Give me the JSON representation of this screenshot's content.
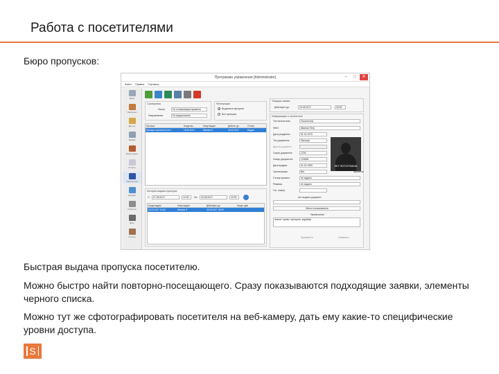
{
  "slide": {
    "title": "Работа с посетителями",
    "subtitle": "Бюро пропусков:",
    "paragraphs": [
      "Быстрая выдача пропуска посетителю.",
      "Можно быстро найти повторно-посещающего. Сразу показываются подходящие заявки, элементы черного списка.",
      "Можно тут же сфотографировать посетителя на веб-камеру, дать ему какие-то специфические уровни доступа."
    ],
    "logo_letter": "S",
    "accent_color": "#e8783c"
  },
  "app": {
    "window_title": "Программа управления [Administrator]",
    "window_controls": [
      "–",
      "□",
      "✕"
    ],
    "menu": [
      "Файл",
      "Правка",
      "Справка"
    ],
    "left_panel": [
      {
        "label": "Бюро",
        "icon": "clipboard-icon"
      },
      {
        "label": "Персонал",
        "icon": "people-icon"
      },
      {
        "label": "Доступ",
        "icon": "shield-icon"
      },
      {
        "label": "Заявки",
        "icon": "form-icon"
      },
      {
        "label": "Мониторинг",
        "icon": "monitor-icon"
      },
      {
        "label": "Отчёты",
        "icon": "report-icon"
      },
      {
        "label": "Посетители",
        "icon": "visitor-icon"
      },
      {
        "label": "Журнал",
        "icon": "log-icon"
      },
      {
        "label": "События",
        "icon": "event-icon"
      },
      {
        "label": "Фото",
        "icon": "photo-icon"
      },
      {
        "label": "Отчеты",
        "icon": "document-icon"
      }
    ],
    "toolbar": [
      {
        "name": "add-visitor-icon",
        "color": "#4f9d3a"
      },
      {
        "name": "edit-visitor-icon",
        "color": "#3b86c8"
      },
      {
        "name": "issue-pass-icon",
        "color": "#2e8a57"
      },
      {
        "name": "refresh-icon",
        "color": "#5a7fa8"
      },
      {
        "name": "print-icon",
        "color": "#7a7a7a"
      },
      {
        "name": "delete-icon",
        "color": "#d23a2a"
      }
    ],
    "sorting": {
      "caption": "Сортировка",
      "key_label": "Поиск:",
      "key_value": "По оставшемуся времени",
      "direction_label": "Направление:",
      "direction_value": "По возрастанию"
    },
    "filtering": {
      "caption": "Фильтрация",
      "option_issued": "Выданные пропуска",
      "option_all": "Все пропуска"
    },
    "passes_grid": {
      "headers": [
        "Пропуск",
        "Когда вы...",
        "Кому выдан",
        "Действ. до",
        "Статус"
      ],
      "rows": [
        [
          "Пропуск посетителя № 1",
          "15.05.2017",
          "Иванов П.",
          "20.05.2017",
          "Выдан"
        ]
      ]
    },
    "history": {
      "caption": "История выдачи пропуска",
      "from_label": "С:",
      "from_date": "07.05.2017",
      "from_time": "12:00",
      "to_label": "По:",
      "to_date": "15.05.2017",
      "to_time": "13:00",
      "headers": [
        "Когда выдан",
        "Кому выдан",
        "Действует до",
        "Когда сдан"
      ],
      "rows": [
        [
          "15.05.2017 10:20",
          "Иванов П.",
          "20.05.2017 09:00",
          ""
        ]
      ]
    },
    "current_pass": {
      "caption": "Текущая заявка",
      "valid_label": "Действует до:",
      "valid_date": "15.05.2017",
      "valid_time": "00:00"
    },
    "visitor_info": {
      "caption": "Информация о посетителе",
      "fields": [
        {
          "label": "Тип посетителя:",
          "value": "Посетитель"
        },
        {
          "label": "ФИО:",
          "value": "Иванов Петр"
        },
        {
          "label": "Дата рождения:",
          "value": "01.01.1970"
        },
        {
          "label": "Тип документа:",
          "value": "Паспорт"
        },
        {
          "label": "Другой документ:",
          "value": ""
        },
        {
          "label": "Серия документа:",
          "value": "1234"
        },
        {
          "label": "Номер документа:",
          "value": "123456"
        },
        {
          "label": "Дата выдачи:",
          "value": "01.01.1990"
        },
        {
          "label": "Организация:",
          "value": "Вег"
        },
        {
          "label": "К кому пришел:",
          "value": "не задано"
        },
        {
          "label": "Режимы:",
          "value": "не задано"
        },
        {
          "label": "Гос. номер:",
          "value": ""
        }
      ],
      "photo_label": "НЕТ ФОТОГРАФИИ",
      "photo_side_label": "архивное",
      "attached_doc_label": "Акт выдачи документ:",
      "user_place_label": "Место пользователя",
      "note_label": "Примечание:",
      "note_value": "значит: право. пропуска. ккуубуки",
      "apply_label": "Применить",
      "cancel_label": "Отменить"
    }
  }
}
